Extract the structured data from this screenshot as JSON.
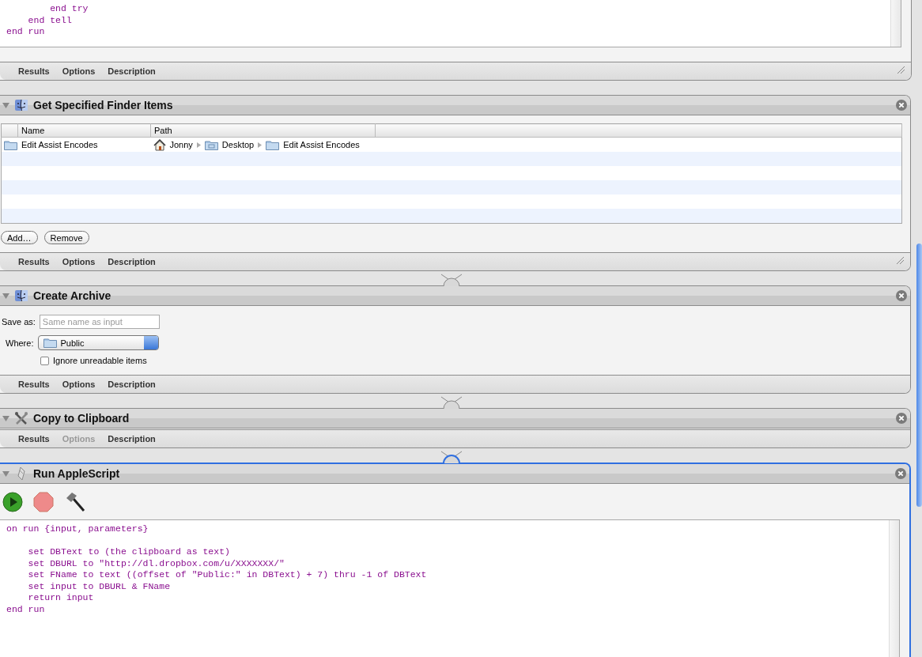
{
  "actions": [
    {
      "kind": "script_tail",
      "code": [
        "        end try",
        "    end tell",
        "end run"
      ],
      "tabs": [
        {
          "label": "Results",
          "disabled": false
        },
        {
          "label": "Options",
          "disabled": false
        },
        {
          "label": "Description",
          "disabled": false
        }
      ]
    },
    {
      "kind": "finder_items",
      "title": "Get Specified Finder Items",
      "expanded": true,
      "selected": false,
      "table": {
        "columns": [
          "Name",
          "Path"
        ],
        "rows": [
          {
            "name": "Edit Assist Encodes",
            "path": [
              {
                "kind": "home",
                "label": "Jonny"
              },
              {
                "kind": "desktop",
                "label": "Desktop"
              },
              {
                "kind": "folder",
                "label": "Edit Assist Encodes"
              }
            ]
          }
        ]
      },
      "buttons": [
        "Add…",
        "Remove"
      ],
      "tabs": [
        {
          "label": "Results",
          "disabled": false
        },
        {
          "label": "Options",
          "disabled": false
        },
        {
          "label": "Description",
          "disabled": false
        }
      ]
    },
    {
      "kind": "archive",
      "title": "Create Archive",
      "expanded": true,
      "selected": false,
      "save_as": {
        "label": "Save as:",
        "placeholder": "Same name as input"
      },
      "where": {
        "label": "Where:",
        "value": "Public"
      },
      "ignore": {
        "label": "Ignore unreadable items",
        "checked": false
      },
      "tabs": [
        {
          "label": "Results",
          "disabled": false
        },
        {
          "label": "Options",
          "disabled": false
        },
        {
          "label": "Description",
          "disabled": false
        }
      ]
    },
    {
      "kind": "clipboard",
      "title": "Copy to Clipboard",
      "expanded": true,
      "selected": false,
      "tabs": [
        {
          "label": "Results",
          "disabled": false
        },
        {
          "label": "Options",
          "disabled": true
        },
        {
          "label": "Description",
          "disabled": false
        }
      ]
    },
    {
      "kind": "applescript",
      "title": "Run AppleScript",
      "expanded": true,
      "selected": true,
      "code": [
        "on run {input, parameters}",
        {
          "text": "    set DBText to (the clipboard as text)",
          "blank_line_before": true
        },
        "    set DBURL to \"http://dl.dropbox.com/u/XXXXXXX/\"",
        "    set FName to text ((offset of \"Public:\" in DBText) + 7) thru -1 of DBText",
        "    set input to DBURL & FName",
        "    return input",
        "end run"
      ]
    }
  ]
}
